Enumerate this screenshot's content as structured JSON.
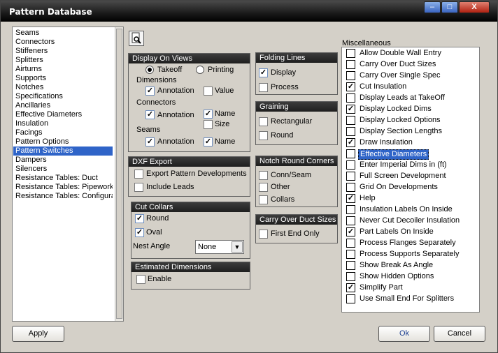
{
  "window": {
    "title": "Pattern Database"
  },
  "titlebar": {
    "min": "–",
    "max": "□",
    "close": "X"
  },
  "left_list": {
    "items": [
      "Seams",
      "Connectors",
      "Stiffeners",
      "Splitters",
      "Airturns",
      "Supports",
      "Notches",
      "Specifications",
      "Ancillaries",
      "Effective Diameters",
      "Insulation",
      "Facings",
      "Pattern Options",
      "Pattern Switches",
      "Dampers",
      "Silencers",
      "Resistance Tables: Duct",
      "Resistance Tables: Pipework",
      "Resistance Tables: Configura"
    ],
    "selected": "Pattern Switches"
  },
  "display_on_views": {
    "title": "Display On Views",
    "takeoff": "Takeoff",
    "printing": "Printing",
    "dimensions": "Dimensions",
    "annotation": "Annotation",
    "value": "Value",
    "connectors": "Connectors",
    "name": "Name",
    "size": "Size",
    "seams": "Seams"
  },
  "dxf_export": {
    "title": "DXF Export",
    "export_pattern": "Export Pattern Developments",
    "include_leads": "Include Leads"
  },
  "cut_collars": {
    "title": "Cut Collars",
    "round": "Round",
    "oval": "Oval",
    "nest_angle": "Nest Angle",
    "nest_value": "None"
  },
  "estimated_dims": {
    "title": "Estimated Dimensions",
    "enable": "Enable"
  },
  "folding_lines": {
    "title": "Folding Lines",
    "display": "Display",
    "process": "Process"
  },
  "graining": {
    "title": "Graining",
    "rectangular": "Rectangular",
    "round": "Round"
  },
  "notch_round": {
    "title": "Notch Round Corners",
    "conn_seam": "Conn/Seam",
    "other": "Other",
    "collars": "Collars"
  },
  "carry_over": {
    "title": "Carry Over Duct Sizes",
    "first_end": "First End Only"
  },
  "misc": {
    "title": "Miscellaneous",
    "items": [
      {
        "label": "Allow Double Wall Entry",
        "checked": false
      },
      {
        "label": "Carry Over Duct Sizes",
        "checked": false
      },
      {
        "label": "Carry Over Single Spec",
        "checked": false
      },
      {
        "label": "Cut Insulation",
        "checked": true
      },
      {
        "label": "Display Leads at TakeOff",
        "checked": false
      },
      {
        "label": "Display Locked Dims",
        "checked": true
      },
      {
        "label": "Display Locked Options",
        "checked": false
      },
      {
        "label": "Display Section Lengths",
        "checked": false
      },
      {
        "label": "Draw Insulation",
        "checked": true
      },
      {
        "label": "Effective Diameters",
        "checked": false
      },
      {
        "label": "Enter Imperial Dims in (ft)",
        "checked": false
      },
      {
        "label": "Full Screen Development",
        "checked": false
      },
      {
        "label": "Grid On Developments",
        "checked": false
      },
      {
        "label": "Help",
        "checked": true
      },
      {
        "label": "Insulation Labels On Inside",
        "checked": false
      },
      {
        "label": "Never Cut Decoiler Insulation",
        "checked": false
      },
      {
        "label": "Part Labels On Inside",
        "checked": true
      },
      {
        "label": "Process Flanges Separately",
        "checked": false
      },
      {
        "label": "Process Supports Separately",
        "checked": false
      },
      {
        "label": "Show Break As Angle",
        "checked": false
      },
      {
        "label": "Show Hidden Options",
        "checked": false
      },
      {
        "label": "Simplify Part",
        "checked": true
      },
      {
        "label": "Use Small End For Splitters",
        "checked": false
      }
    ]
  },
  "buttons": {
    "apply": "Apply",
    "ok": "Ok",
    "cancel": "Cancel"
  }
}
